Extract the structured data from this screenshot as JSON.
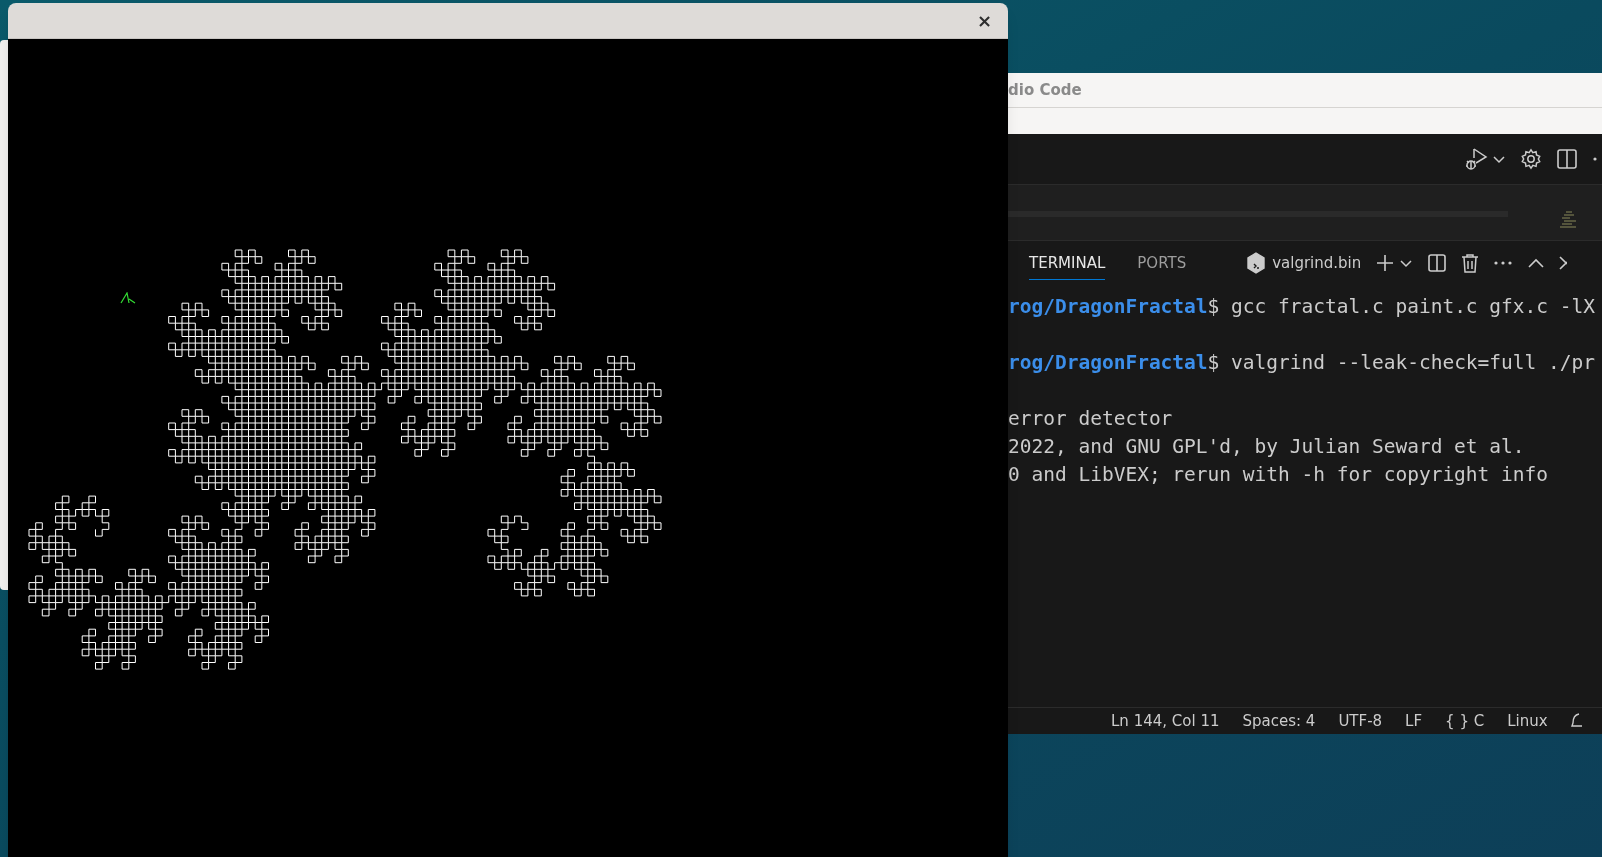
{
  "fractal_window": {
    "close_glyph": "×"
  },
  "code_window": {
    "title": "dio Code",
    "panel_tabs": [
      {
        "label": "TERMINAL",
        "selected": true
      },
      {
        "label": "PORTS",
        "selected": false
      }
    ],
    "terminal_name": "valgrind.bin",
    "terminal_lines": [
      {
        "kind": "prompt",
        "prompt": "rog/DragonFractal",
        "command": "$ gcc fractal.c paint.c gfx.c -lX"
      },
      {
        "kind": "prompt",
        "prompt": "rog/DragonFractal",
        "command": "$ valgrind --leak-check=full ./pr"
      },
      {
        "kind": "output",
        "text": "error detector"
      },
      {
        "kind": "output",
        "text": "2022, and GNU GPL'd, by Julian Seward et al."
      },
      {
        "kind": "output",
        "text": "0 and LibVEX; rerun with -h for copyright info"
      }
    ],
    "status_bar": [
      "Ln 144, Col 11",
      "Spaces: 4",
      "UTF-8",
      "LF",
      "{ } C",
      "Linux"
    ]
  }
}
